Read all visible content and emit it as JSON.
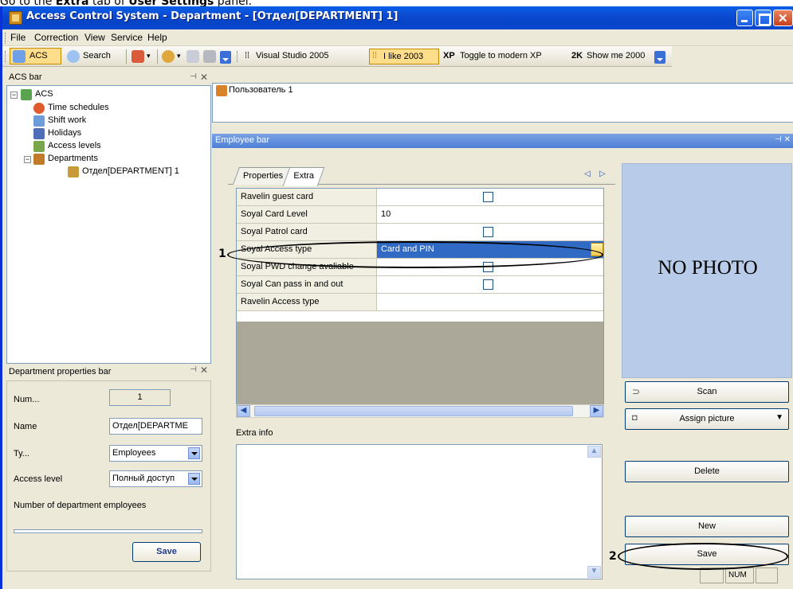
{
  "caption": {
    "prefix": "Go to the ",
    "tab": "Extra",
    "mid": " tab of ",
    "panel": "User Settings",
    "suffix": " panel."
  },
  "window": {
    "title": "Access Control System - Department - [Отдел[DEPARTMENT] 1]"
  },
  "menu": [
    "File",
    "Correction",
    "View",
    "Service",
    "Help"
  ],
  "toolbar": {
    "acs": "ACS",
    "search": "Search",
    "vs2005": "Visual Studio 2005",
    "like2003": "I like 2003",
    "xp_badge": "XP",
    "xp": "Toggle to modern XP",
    "k2_badge": "2K",
    "k2": "Show me 2000"
  },
  "acs_bar": {
    "title": "ACS bar",
    "tree": {
      "root": "ACS",
      "items": [
        "Time schedules",
        "Shift work",
        "Holidays",
        "Access levels",
        "Departments"
      ],
      "child": "Отдел[DEPARTMENT] 1"
    }
  },
  "dept_bar": {
    "title": "Department properties bar",
    "num_label": "Num...",
    "num_value": "1",
    "name_label": "Name",
    "name_value": "Отдел[DEPARTME",
    "type_label": "Ty...",
    "type_value": "Employees",
    "access_label": "Access level",
    "access_value": "Полный доступ",
    "count_label": "Number of department employees",
    "save": "Save"
  },
  "user_list": {
    "user": "Пользователь 1"
  },
  "employee_bar": {
    "title": "Employee bar",
    "tabs": [
      "Properties",
      "Extra"
    ],
    "rows": [
      {
        "label": "Ravelin guest card",
        "value": "",
        "checkbox": true
      },
      {
        "label": "Soyal Card Level",
        "value": "10",
        "checkbox": false
      },
      {
        "label": "Soyal Patrol card",
        "value": "",
        "checkbox": true
      },
      {
        "label": "Soyal Access type",
        "value": "Card and PIN",
        "checkbox": false
      },
      {
        "label": "Soyal PWD change avaliable",
        "value": "",
        "checkbox": true
      },
      {
        "label": "Soyal Can pass in and out",
        "value": "",
        "checkbox": true
      },
      {
        "label": "Ravelin Access type",
        "value": "",
        "checkbox": false
      }
    ],
    "extra_info": "Extra info",
    "photo": "NO PHOTO",
    "scan": "Scan",
    "assign": "Assign picture",
    "delete": "Delete",
    "new": "New",
    "save": "Save"
  },
  "callouts": [
    "1",
    "2"
  ],
  "status": {
    "num": "NUM"
  }
}
